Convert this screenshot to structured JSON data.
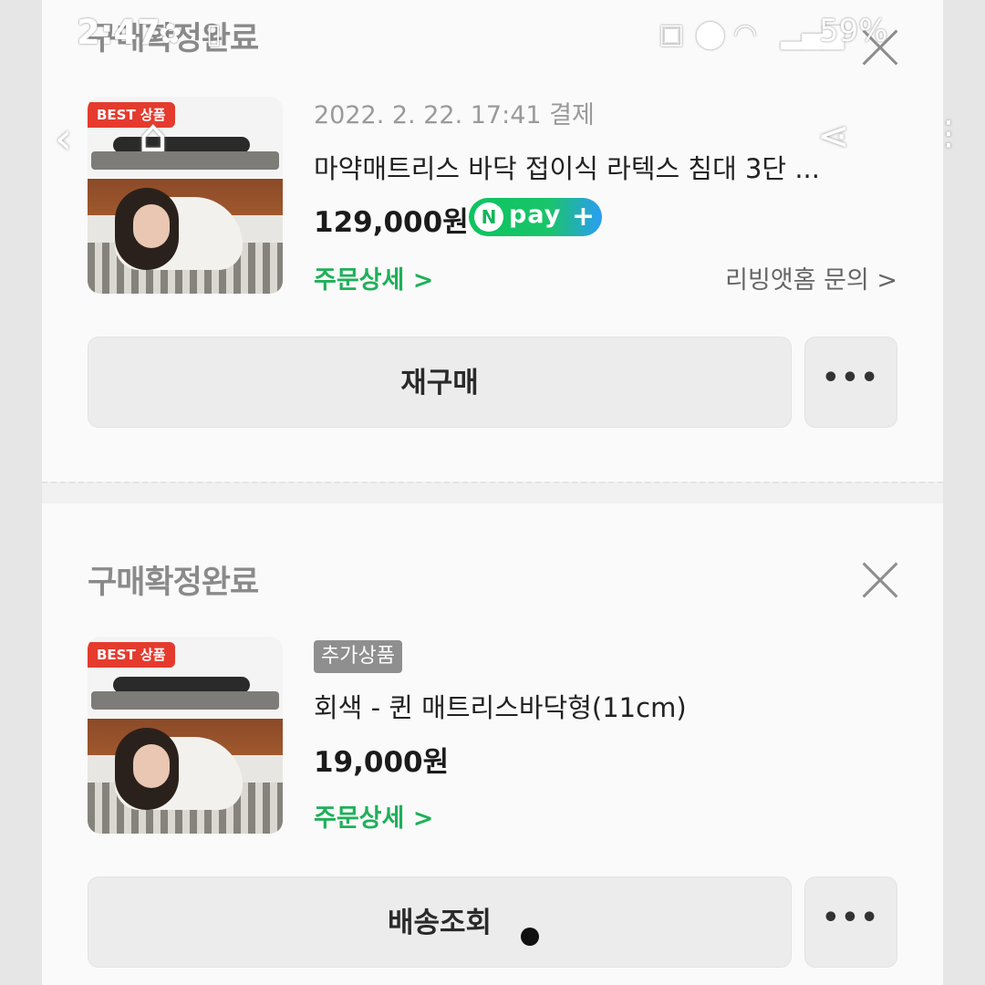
{
  "status_bar": {
    "time": "2:47",
    "battery": "59%"
  },
  "header": {
    "back_icon": "chevron-left-icon",
    "home_icon": "home-icon",
    "share_icon": "share-icon"
  },
  "orders": [
    {
      "status": "구매확정완료",
      "badge": "BEST 상품",
      "date": "2022. 2. 22. 17:41 결제",
      "name": "마약매트리스 바닥 접이식 라텍스 침대 3단 ...",
      "price": "129,000원",
      "npay": {
        "n": "N",
        "label": "pay",
        "plus": "+"
      },
      "detail_link": "주문상세 >",
      "inquiry_link": "리빙앳홈 문의 >",
      "primary_button": "재구매",
      "more_button": "•••"
    },
    {
      "status": "구매확정완료",
      "badge": "BEST 상품",
      "tag": "추가상품",
      "name": "회색 - 퀸 매트리스바닥형(11cm)",
      "price": "19,000원",
      "detail_link": "주문상세 >",
      "primary_button": "배송조회",
      "more_button": "•••"
    }
  ],
  "colors": {
    "accent_green": "#1fb05a",
    "badge_red": "#e43b2e",
    "npay_green": "#0bc55e"
  }
}
